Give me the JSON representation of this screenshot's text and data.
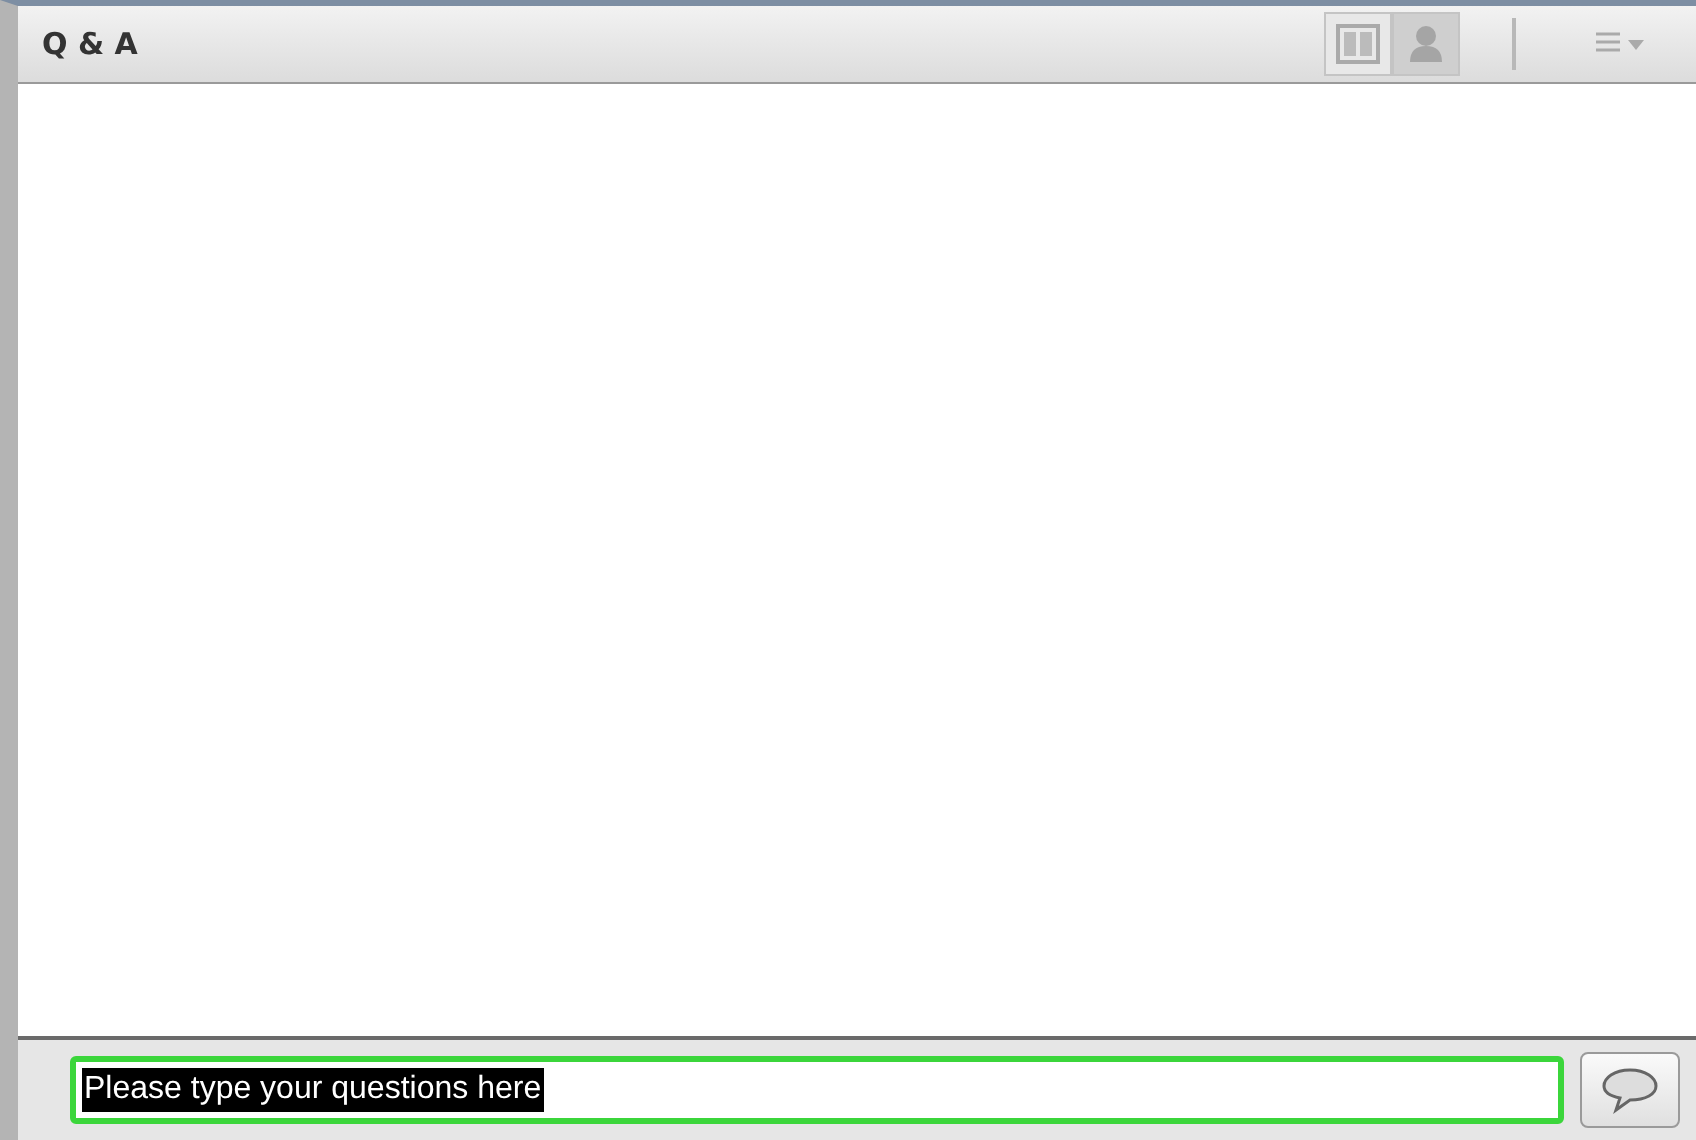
{
  "panel": {
    "title": "Q & A"
  },
  "view_toggles": [
    {
      "kind": "split",
      "selected": false
    },
    {
      "kind": "person",
      "selected": true
    }
  ],
  "input": {
    "value": "Please type your questions here",
    "highlighted": true,
    "focused": true
  }
}
